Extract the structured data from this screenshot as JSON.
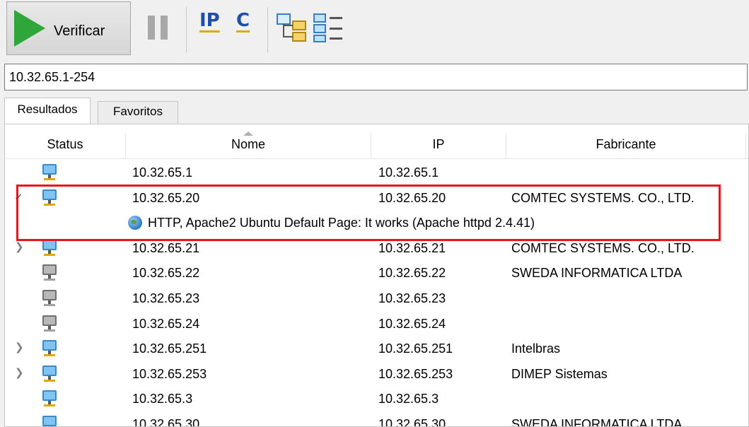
{
  "toolbar": {
    "scan_label": "Verificar",
    "ip_label": "IP",
    "c_label": "C"
  },
  "address": {
    "value": "10.32.65.1-254"
  },
  "tabs": [
    {
      "label": "Resultados",
      "active": true
    },
    {
      "label": "Favoritos",
      "active": false
    }
  ],
  "columns": [
    "Status",
    "Nome",
    "IP",
    "Fabricante"
  ],
  "rows": [
    {
      "name": "10.32.65.1",
      "ip": "10.32.65.1",
      "vendor": "",
      "status": "online",
      "expander": ""
    },
    {
      "name": "10.32.65.20",
      "ip": "10.32.65.20",
      "vendor": "COMTEC SYSTEMS. CO., LTD.",
      "status": "online",
      "expander": "expanded"
    },
    {
      "service": "HTTP, Apache2 Ubuntu Default Page: It works (Apache httpd 2.4.41)"
    },
    {
      "name": "10.32.65.21",
      "ip": "10.32.65.21",
      "vendor": "COMTEC SYSTEMS. CO., LTD.",
      "status": "online",
      "expander": "collapsed"
    },
    {
      "name": "10.32.65.22",
      "ip": "10.32.65.22",
      "vendor": "SWEDA INFORMATICA LTDA",
      "status": "offline",
      "expander": ""
    },
    {
      "name": "10.32.65.23",
      "ip": "10.32.65.23",
      "vendor": "",
      "status": "offline",
      "expander": ""
    },
    {
      "name": "10.32.65.24",
      "ip": "10.32.65.24",
      "vendor": "",
      "status": "offline",
      "expander": ""
    },
    {
      "name": "10.32.65.251",
      "ip": "10.32.65.251",
      "vendor": "Intelbras",
      "status": "online",
      "expander": "collapsed"
    },
    {
      "name": "10.32.65.253",
      "ip": "10.32.65.253",
      "vendor": "DIMEP Sistemas",
      "status": "online",
      "expander": "collapsed"
    },
    {
      "name": "10.32.65.3",
      "ip": "10.32.65.3",
      "vendor": "",
      "status": "online",
      "expander": ""
    },
    {
      "name": "10.32.65.30",
      "ip": "10.32.65.30",
      "vendor": "SWEDA INFORMATICA LTDA",
      "status": "online",
      "expander": ""
    }
  ],
  "colors": {
    "highlight": "#e8141c",
    "play": "#2fa63a",
    "accent": "#1f4fa8"
  }
}
